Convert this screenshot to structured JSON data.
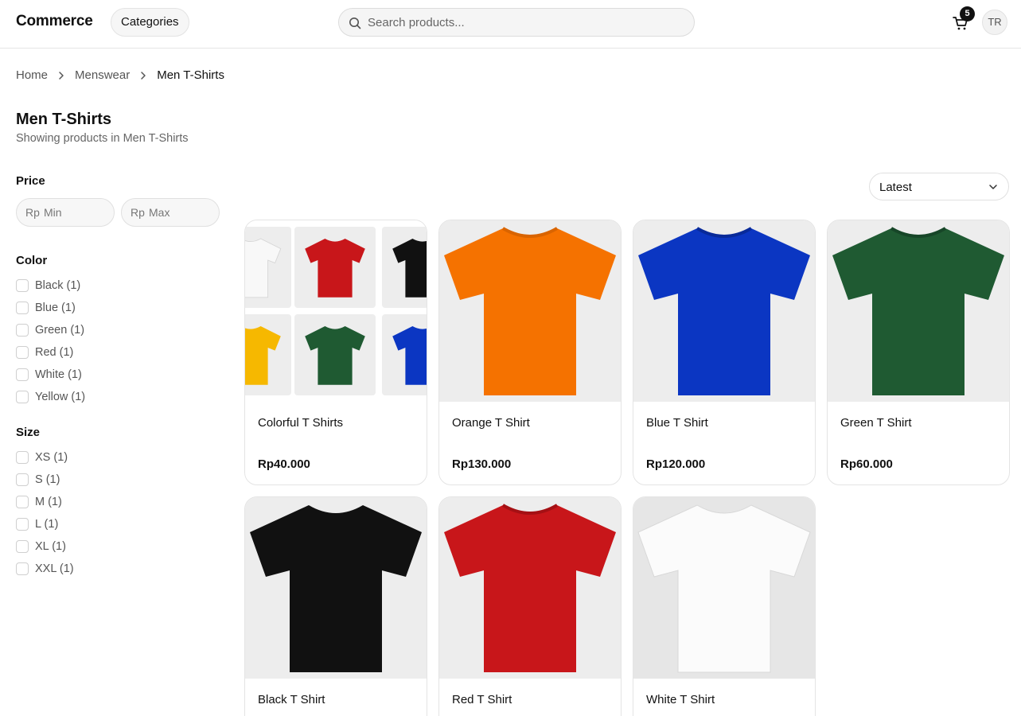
{
  "header": {
    "logo": "Commerce",
    "categories_label": "Categories",
    "search_placeholder": "Search products...",
    "cart_count": "5",
    "avatar_initials": "TR",
    "icons": {
      "search": "search-icon",
      "cart": "cart-icon"
    }
  },
  "breadcrumb": [
    "Home",
    "Menswear",
    "Men T-Shirts"
  ],
  "page": {
    "title": "Men T-Shirts",
    "subtitle": "Showing products in Men T-Shirts"
  },
  "filters": {
    "price": {
      "heading": "Price",
      "currency_prefix": "Rp",
      "min_placeholder": "Min",
      "max_placeholder": "Max"
    },
    "color": {
      "heading": "Color",
      "options": [
        "Black (1)",
        "Blue (1)",
        "Green (1)",
        "Red (1)",
        "White (1)",
        "Yellow (1)"
      ]
    },
    "size": {
      "heading": "Size",
      "options": [
        "XS (1)",
        "S (1)",
        "M (1)",
        "L (1)",
        "XL (1)",
        "XXL (1)"
      ]
    }
  },
  "sort": {
    "selected": "Latest"
  },
  "products": [
    {
      "name": "Colorful T Shirts",
      "price": "Rp40.000",
      "color": "#multi"
    },
    {
      "name": "Orange T Shirt",
      "price": "Rp130.000",
      "color": "#f57200"
    },
    {
      "name": "Blue T Shirt",
      "price": "Rp120.000",
      "color": "#0b36c2"
    },
    {
      "name": "Green T Shirt",
      "price": "Rp60.000",
      "color": "#1f5a32"
    },
    {
      "name": "Black T Shirt",
      "price": "",
      "color": "#111111"
    },
    {
      "name": "Red T Shirt",
      "price": "",
      "color": "#c8161a"
    },
    {
      "name": "White T Shirt",
      "price": "",
      "color": "#f8f8f8"
    }
  ],
  "colors": {
    "text": "#111111",
    "muted": "#666666",
    "border": "#e4e4e4",
    "image_bg": "#ededed"
  }
}
